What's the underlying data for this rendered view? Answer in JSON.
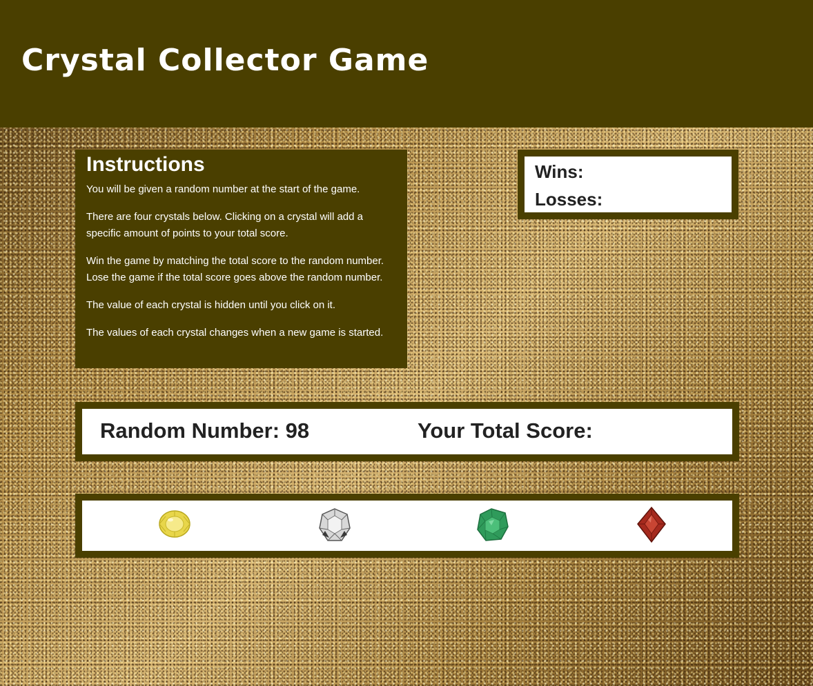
{
  "header": {
    "title": "Crystal Collector Game"
  },
  "instructions": {
    "heading": "Instructions",
    "paragraphs": [
      "You will be given a random number at the start of the game.",
      "There are four crystals below. Clicking on a crystal will add a specific amount of points to your total score.",
      "Win the game by matching the total score to the random number. Lose the game if the total score goes above the random number.",
      "The value of each crystal is hidden until you click on it.",
      "The values of each crystal changes when a new game is started."
    ]
  },
  "record": {
    "wins_label": "Wins:",
    "losses_label": "Losses:"
  },
  "numbers": {
    "random_label": "Random Number: 98",
    "total_label": "Your Total Score:"
  },
  "crystals": [
    {
      "name": "yellow-crystal-icon",
      "color": "#e6d44a"
    },
    {
      "name": "white-crystal-icon",
      "color": "#cfcfcf"
    },
    {
      "name": "green-crystal-icon",
      "color": "#2e9a5a"
    },
    {
      "name": "red-crystal-icon",
      "color": "#a8281c"
    }
  ],
  "colors": {
    "header_bg": "#4a3f00",
    "panel_bg": "#4a3f00"
  }
}
